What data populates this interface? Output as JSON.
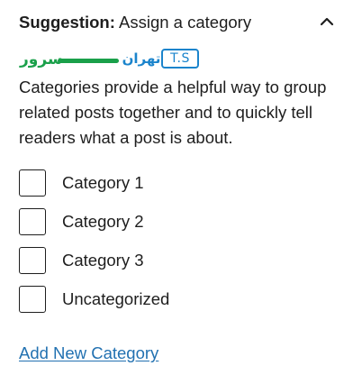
{
  "header": {
    "title_prefix": "Suggestion:",
    "title_rest": "Assign a category",
    "toggle_icon": "chevron-up-icon"
  },
  "logo": {
    "persian_text": "تهران سرور",
    "box_text": "T.S"
  },
  "description": "Categories provide a helpful way to group related posts together and to quickly tell readers what a post is about.",
  "categories": [
    {
      "label": "Category 1",
      "checked": false
    },
    {
      "label": "Category 2",
      "checked": false
    },
    {
      "label": "Category 3",
      "checked": false
    },
    {
      "label": "Uncategorized",
      "checked": false
    }
  ],
  "add_link": "Add New Category",
  "colors": {
    "text": "#1e1e1e",
    "link": "#2271b1",
    "logo_green": "#1aa04a",
    "logo_blue": "#1b84cc"
  }
}
